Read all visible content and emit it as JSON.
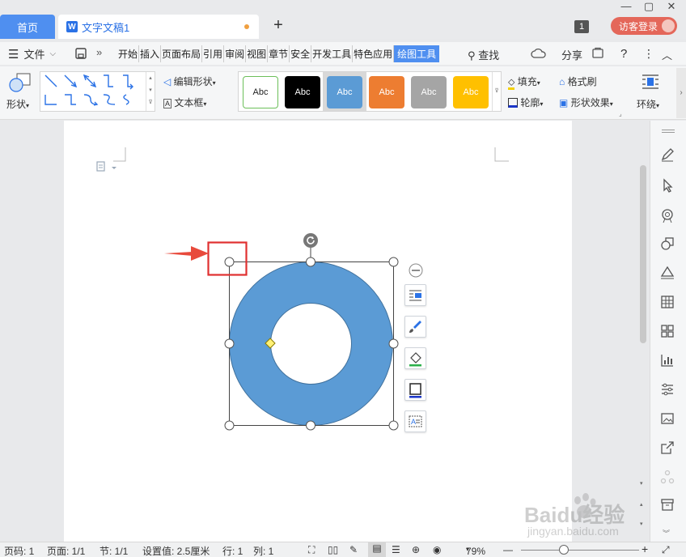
{
  "titlebar": {
    "home_tab": "首页",
    "doc_tab": "文字文稿1",
    "doc_icon": "W",
    "new_tab": "+",
    "badge": "1",
    "login": "访客登录"
  },
  "menubar": {
    "file": "文件",
    "tabs": [
      "开始",
      "插入",
      "页面布局",
      "引用",
      "审阅",
      "视图",
      "章节",
      "安全",
      "开发工具",
      "特色应用",
      "绘图工具"
    ],
    "active_tab": "绘图工具",
    "search": "查找",
    "share": "分享",
    "help": "?"
  },
  "ribbon": {
    "shape_label": "形状",
    "edit_shape": "编辑形状",
    "text_box": "文本框",
    "style_swatches": [
      {
        "label": "Abc",
        "bg": "#ffffff",
        "fg": "#222222",
        "border": "#6cbf5a"
      },
      {
        "label": "Abc",
        "bg": "#000000",
        "fg": "#ffffff",
        "border": "#000000"
      },
      {
        "label": "Abc",
        "bg": "#5b9bd5",
        "fg": "#ffffff",
        "border": "#5b9bd5"
      },
      {
        "label": "Abc",
        "bg": "#ed7d31",
        "fg": "#ffffff",
        "border": "#ed7d31"
      },
      {
        "label": "Abc",
        "bg": "#a5a5a5",
        "fg": "#ffffff",
        "border": "#a5a5a5"
      },
      {
        "label": "Abc",
        "bg": "#ffc000",
        "fg": "#ffffff",
        "border": "#ffc000"
      }
    ],
    "fill": "填充",
    "outline": "轮廓",
    "format_painter": "格式刷",
    "shape_effects": "形状效果",
    "wrap": "环绕"
  },
  "document": {
    "shape_fill": "#5b9bd5",
    "shape_stroke": "#41719c",
    "highlight_color": "#e03030"
  },
  "statusbar": {
    "page_no": "页码: 1",
    "pages": "页面: 1/1",
    "section": "节: 1/1",
    "setting": "设置值: 2.5厘米",
    "row": "行: 1",
    "col": "列: 1",
    "zoom": "79%"
  },
  "watermark": {
    "brand": "Baidu经验",
    "url": "jingyan.baidu.com"
  }
}
